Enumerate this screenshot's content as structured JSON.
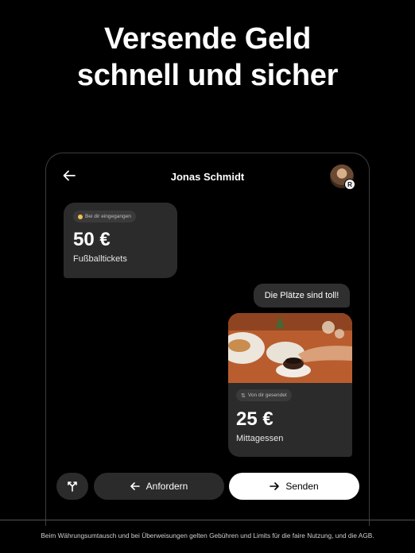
{
  "headline": {
    "line1": "Versende Geld",
    "line2": "schnell und sicher"
  },
  "chat": {
    "contact_name": "Jonas Schmidt",
    "avatar_badge": "R",
    "back_icon": "arrow-left-icon",
    "incoming": {
      "status": "Bei dir eingegangen",
      "amount": "50 €",
      "purpose": "Fußballtickets"
    },
    "outgoing_message": "Die Plätze sind toll!",
    "outgoing_payment": {
      "status": "Von dir gesendet",
      "amount": "25 €",
      "purpose": "Mittagessen"
    }
  },
  "actions": {
    "split_icon": "split-icon",
    "request_label": "Anfordern",
    "send_label": "Senden"
  },
  "footer": {
    "disclaimer": "Beim Währungsumtausch und bei Überweisungen gelten Gebühren und Limits für die faire Nutzung, und die AGB."
  },
  "colors": {
    "background": "#000000",
    "bubble": "#2b2b2b",
    "send_button": "#ffffff"
  }
}
